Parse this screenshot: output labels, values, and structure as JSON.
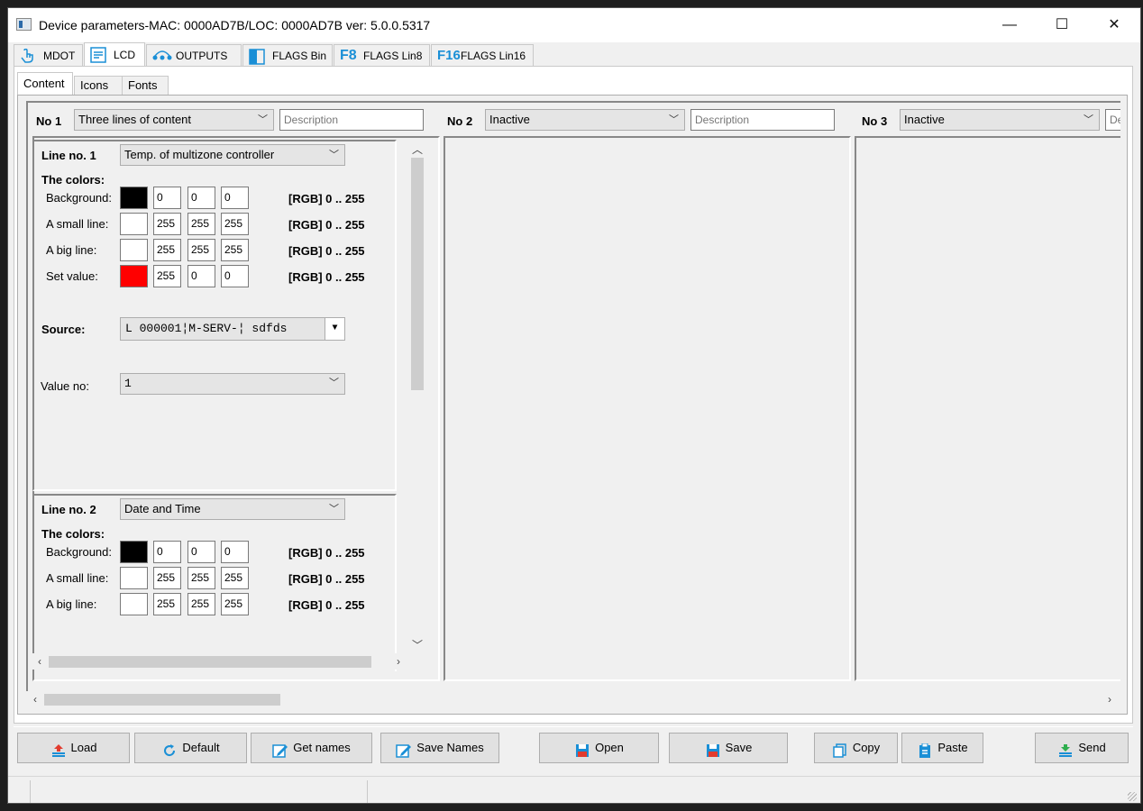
{
  "window": {
    "title": "Device parameters-MAC: 0000AD7B/LOC: 0000AD7B ver: 5.0.0.5317",
    "minimize": "—",
    "maximize": "☐",
    "close": "✕"
  },
  "top_tabs": [
    {
      "label": "MDOT",
      "icon": "touch-icon"
    },
    {
      "label": "LCD",
      "icon": "lcd-list-icon"
    },
    {
      "label": "OUTPUTS",
      "icon": "outputs-icon"
    },
    {
      "label": "FLAGS Bin",
      "icon": "flags-bin-icon"
    },
    {
      "label": "FLAGS Lin8",
      "icon": "f8-icon",
      "glyph": "F8"
    },
    {
      "label": "FLAGS Lin16",
      "icon": "f16-icon",
      "glyph": "F16"
    }
  ],
  "sub_tabs": [
    "Content",
    "Icons",
    "Fonts"
  ],
  "columns": [
    {
      "no": "No 1",
      "mode": "Three lines of content",
      "description_placeholder": "Description"
    },
    {
      "no": "No 2",
      "mode": "Inactive",
      "description_placeholder": "Description"
    },
    {
      "no": "No 3",
      "mode": "Inactive",
      "description_placeholder": "Description"
    }
  ],
  "lines": [
    {
      "title": "Line no. 1",
      "type": "Temp. of multizone controller",
      "colors_label": "The colors:",
      "colors": [
        {
          "label": "Background:",
          "swatch": "#000000",
          "r": "0",
          "g": "0",
          "b": "0",
          "range": "[RGB] 0 .. 255"
        },
        {
          "label": "A small line:",
          "swatch": "#ffffff",
          "r": "255",
          "g": "255",
          "b": "255",
          "range": "[RGB] 0 .. 255"
        },
        {
          "label": "A big line:",
          "swatch": "#ffffff",
          "r": "255",
          "g": "255",
          "b": "255",
          "range": "[RGB] 0 .. 255"
        },
        {
          "label": "Set value:",
          "swatch": "#ff0000",
          "r": "255",
          "g": "0",
          "b": "0",
          "range": "[RGB] 0 .. 255"
        }
      ],
      "source_label": "Source:",
      "source_value": "L 000001¦M-SERV-¦ sdfds",
      "value_no_label": "Value no:",
      "value_no": "1"
    },
    {
      "title": "Line no. 2",
      "type": "Date and Time",
      "colors_label": "The colors:",
      "colors": [
        {
          "label": "Background:",
          "swatch": "#000000",
          "r": "0",
          "g": "0",
          "b": "0",
          "range": "[RGB] 0 .. 255"
        },
        {
          "label": "A small line:",
          "swatch": "#ffffff",
          "r": "255",
          "g": "255",
          "b": "255",
          "range": "[RGB] 0 .. 255"
        },
        {
          "label": "A big line:",
          "swatch": "#ffffff",
          "r": "255",
          "g": "255",
          "b": "255",
          "range": "[RGB] 0 .. 255"
        }
      ]
    }
  ],
  "buttons": {
    "load": "Load",
    "default": "Default",
    "get_names": "Get names",
    "save_names": "Save Names",
    "open": "Open",
    "save": "Save",
    "copy": "Copy",
    "paste": "Paste",
    "send": "Send"
  },
  "colors": {
    "accent": "#1a8fd6"
  }
}
